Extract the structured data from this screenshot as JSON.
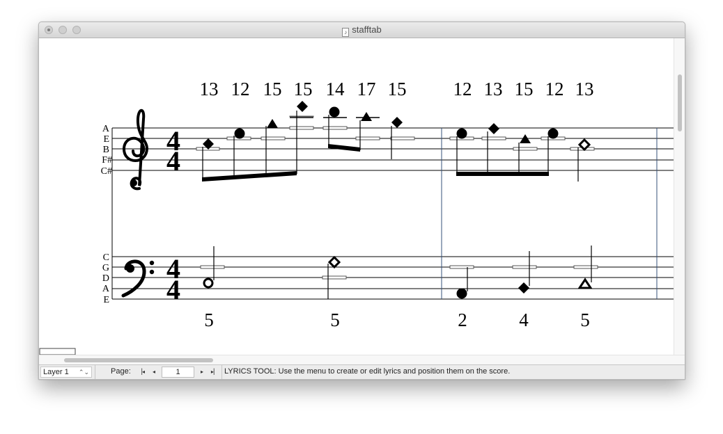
{
  "window": {
    "title": "stafftab",
    "title_icon": "music-document-icon"
  },
  "score": {
    "treble": {
      "clef": "treble-clef",
      "time_signature": [
        "4",
        "4"
      ],
      "string_labels": [
        "A",
        "E",
        "B",
        "F#",
        "C#"
      ],
      "fret_numbers": [
        "13",
        "12",
        "15",
        "15",
        "14",
        "17",
        "15",
        "12",
        "13",
        "15",
        "12",
        "13"
      ]
    },
    "bass": {
      "clef": "bass-clef",
      "time_signature": [
        "4",
        "4"
      ],
      "string_labels": [
        "C",
        "G",
        "D",
        "A",
        "E"
      ],
      "fret_numbers": [
        "5",
        "5",
        "2",
        "4",
        "5"
      ]
    }
  },
  "statusbar": {
    "layer": "Layer 1",
    "page_label": "Page:",
    "page_value": "1",
    "first_icon": "▕◂",
    "prev_icon": "◂",
    "next_icon": "▸",
    "last_icon": "▸▏",
    "message": "LYRICS TOOL: Use the menu to create or edit lyrics and position them on the score."
  }
}
